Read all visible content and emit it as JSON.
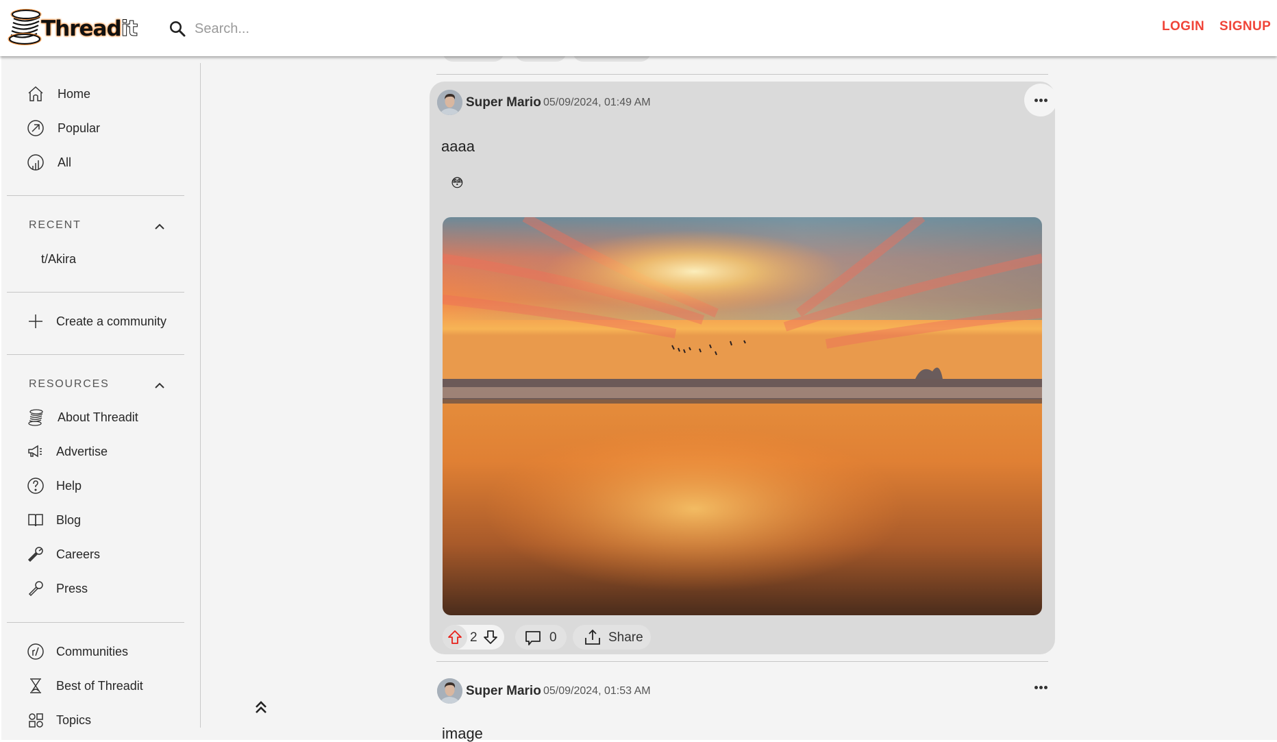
{
  "app": {
    "name": "Threadit"
  },
  "header": {
    "logo_text": "Thread",
    "logo_suffix": "it",
    "search_placeholder": "Search...",
    "search_value": "",
    "login_label": "LOGIN",
    "signup_label": "SIGNUP",
    "accent_color": "#f04438"
  },
  "sidebar": {
    "main_nav": [
      {
        "label": "Home",
        "icon": "home-icon"
      },
      {
        "label": "Popular",
        "icon": "trending-icon"
      },
      {
        "label": "All",
        "icon": "all-chart-icon"
      }
    ],
    "recent": {
      "heading": "RECENT",
      "expanded": true,
      "items": [
        {
          "label": "t/Akira"
        }
      ]
    },
    "create_community": {
      "label": "Create a community",
      "icon": "plus-icon"
    },
    "resources": {
      "heading": "RESOURCES",
      "expanded": true,
      "items": [
        {
          "label": "About Threadit",
          "icon": "threadit-spool-icon"
        },
        {
          "label": "Advertise",
          "icon": "megaphone-icon"
        },
        {
          "label": "Help",
          "icon": "help-circle-icon"
        },
        {
          "label": "Blog",
          "icon": "book-icon"
        },
        {
          "label": "Careers",
          "icon": "wrench-icon"
        },
        {
          "label": "Press",
          "icon": "microphone-icon"
        }
      ]
    },
    "explore": [
      {
        "label": "Communities",
        "icon": "communities-icon"
      },
      {
        "label": "Best of Threadit",
        "icon": "hourglass-icon"
      },
      {
        "label": "Topics",
        "icon": "topics-grid-icon"
      }
    ],
    "back_to_top_icon": "double-chevron-up-icon"
  },
  "feed": {
    "posts": [
      {
        "author": "Super Mario",
        "timestamp": "05/09/2024, 01:49 AM",
        "title": "aaaa",
        "emoji": "😳",
        "image": {
          "alt": "Sunset over the ocean beach with birds in flight"
        },
        "votes": 2,
        "upvoted": true,
        "comments": 0,
        "share_label": "Share",
        "hovered": true
      },
      {
        "author": "Super Mario",
        "timestamp": "05/09/2024, 01:53 AM",
        "title": "image"
      }
    ],
    "upvote_color": "#e8201a"
  }
}
